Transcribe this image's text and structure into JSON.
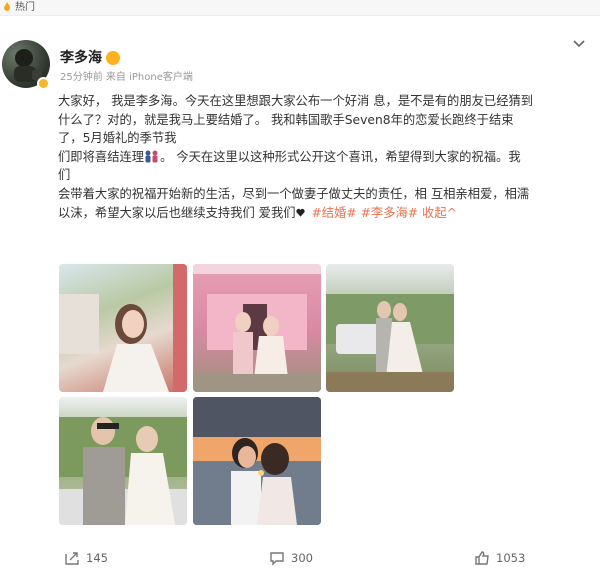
{
  "topbar": {
    "label": "热门"
  },
  "post": {
    "author": "李多海",
    "time": "25分钟前",
    "source": "来自 iPhone客户端",
    "lines": [
      "大家好， 我是李多海。今天在这里想跟大家公布一个好消 息，是不是有的朋友已经猜到",
      "什么了？对的，就是我马上要结婚了。 我和韩国歌手Seven8年的恋爱长跑终于结束",
      "了，5月婚礼的季节我"
    ],
    "line4_a": "们即将喜结连理",
    "line4_b": "。 今天在这里以这种形式公开这个喜讯，希望得到大家的祝福。我",
    "line5": "们",
    "line6": "会带着大家的祝福开始新的生活，尽到一个做妻子做丈夫的责任，相 互相亲相爱，相濡",
    "line7_text": "以沫，希望大家以后也继续支持我们 爱我们",
    "tag1": "#结婚#",
    "tag2": "#李多海#",
    "collapse": "收起^"
  },
  "actions": {
    "repost_count": "145",
    "comment_count": "300",
    "like_count": "1053"
  },
  "colors": {
    "link": "#eb7350",
    "badge": "#f6b628"
  },
  "icons": [
    "hot-icon",
    "verified-badge-icon",
    "chevron-down-icon",
    "repost-icon",
    "comment-icon",
    "like-icon"
  ]
}
